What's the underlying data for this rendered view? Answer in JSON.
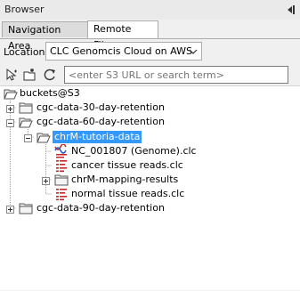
{
  "panel": {
    "title": "Browser"
  },
  "tabs": [
    {
      "label": "Navigation Area"
    },
    {
      "label": "Remote Files"
    }
  ],
  "location": {
    "label": "Location",
    "selected": "CLC Genomcis Cloud on AWS"
  },
  "search": {
    "placeholder": "<enter S3 URL or search term>"
  },
  "tree": {
    "root": "buckets@S3",
    "items": [
      {
        "label": "cgc-data-30-day-retention"
      },
      {
        "label": "cgc-data-60-day-retention"
      },
      {
        "label": "chrM-tutoria-data"
      },
      {
        "label": "NC_001807 (Genome).clc"
      },
      {
        "label": "cancer tissue reads.clc"
      },
      {
        "label": "chrM-mapping-results"
      },
      {
        "label": "normal tissue reads.clc"
      },
      {
        "label": "cgc-data-90-day-retention"
      }
    ]
  },
  "colors": {
    "selection": "#3399ff",
    "reads_icon": "#cc2222",
    "folder": "#f4f4f4"
  }
}
